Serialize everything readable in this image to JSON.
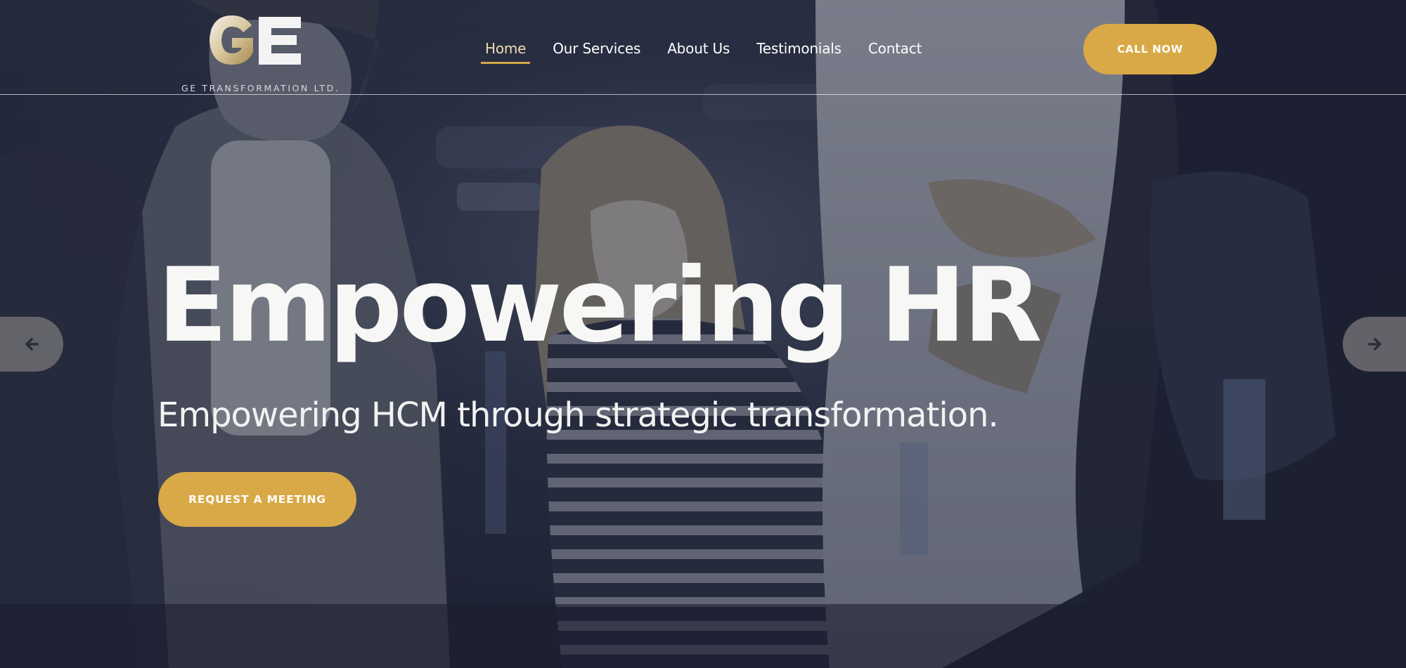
{
  "brand": {
    "logo_letters": "GE",
    "company_name": "GE TRANSFORMATION LTD."
  },
  "nav": {
    "items": [
      {
        "label": "Home",
        "active": true
      },
      {
        "label": "Our Services",
        "active": false
      },
      {
        "label": "About Us",
        "active": false
      },
      {
        "label": "Testimonials",
        "active": false
      },
      {
        "label": "Contact",
        "active": false
      }
    ]
  },
  "header": {
    "call_label": "CALL NOW"
  },
  "hero": {
    "title": "Empowering HR",
    "subtitle": "Empowering HCM through strategic transformation.",
    "cta_label": "REQUEST A MEETING"
  },
  "slider": {
    "prev_icon": "arrow-left-icon",
    "next_icon": "arrow-right-icon"
  },
  "colors": {
    "accent": "#d8a946",
    "background": "#1f2334",
    "text": "#ffffff"
  }
}
